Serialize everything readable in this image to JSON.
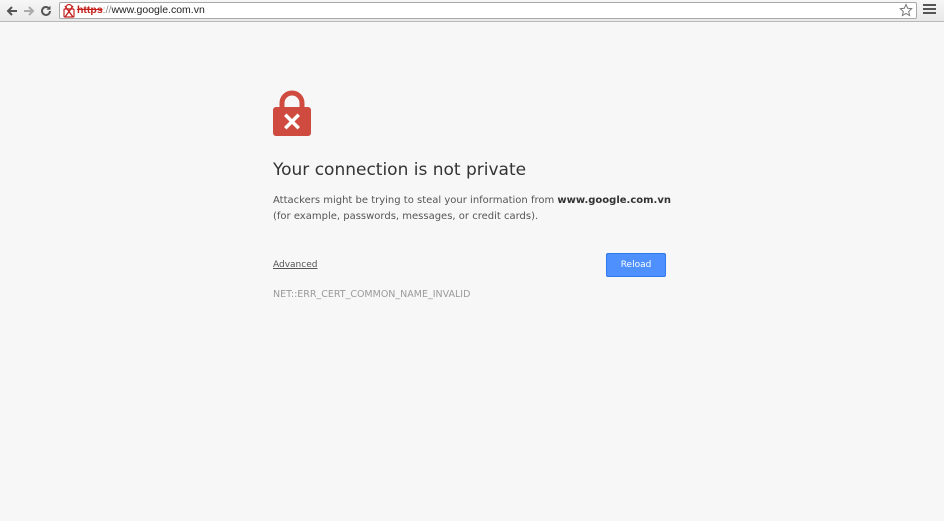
{
  "toolbar": {
    "back_icon": "back-arrow-icon",
    "forward_icon": "forward-arrow-icon",
    "reload_icon": "reload-icon",
    "url_scheme": "https",
    "url_separator": "://",
    "url_host": "www.google.com.vn",
    "star_icon": "star-icon",
    "menu_icon": "hamburger-menu-icon"
  },
  "interstitial": {
    "lock_icon": "broken-lock-icon",
    "heading": "Your connection is not private",
    "description_before": "Attackers might be trying to steal your information from ",
    "description_host": "www.google.com.vn",
    "description_after": " (for example, passwords, messages, or credit cards).",
    "advanced_label": "Advanced",
    "reload_label": "Reload",
    "error_code": "NET::ERR_CERT_COMMON_NAME_INVALID"
  },
  "colors": {
    "background": "#f7f7f7",
    "lock": "#d04b3f",
    "button": "#4d90fe",
    "url_error": "#c5221f"
  }
}
